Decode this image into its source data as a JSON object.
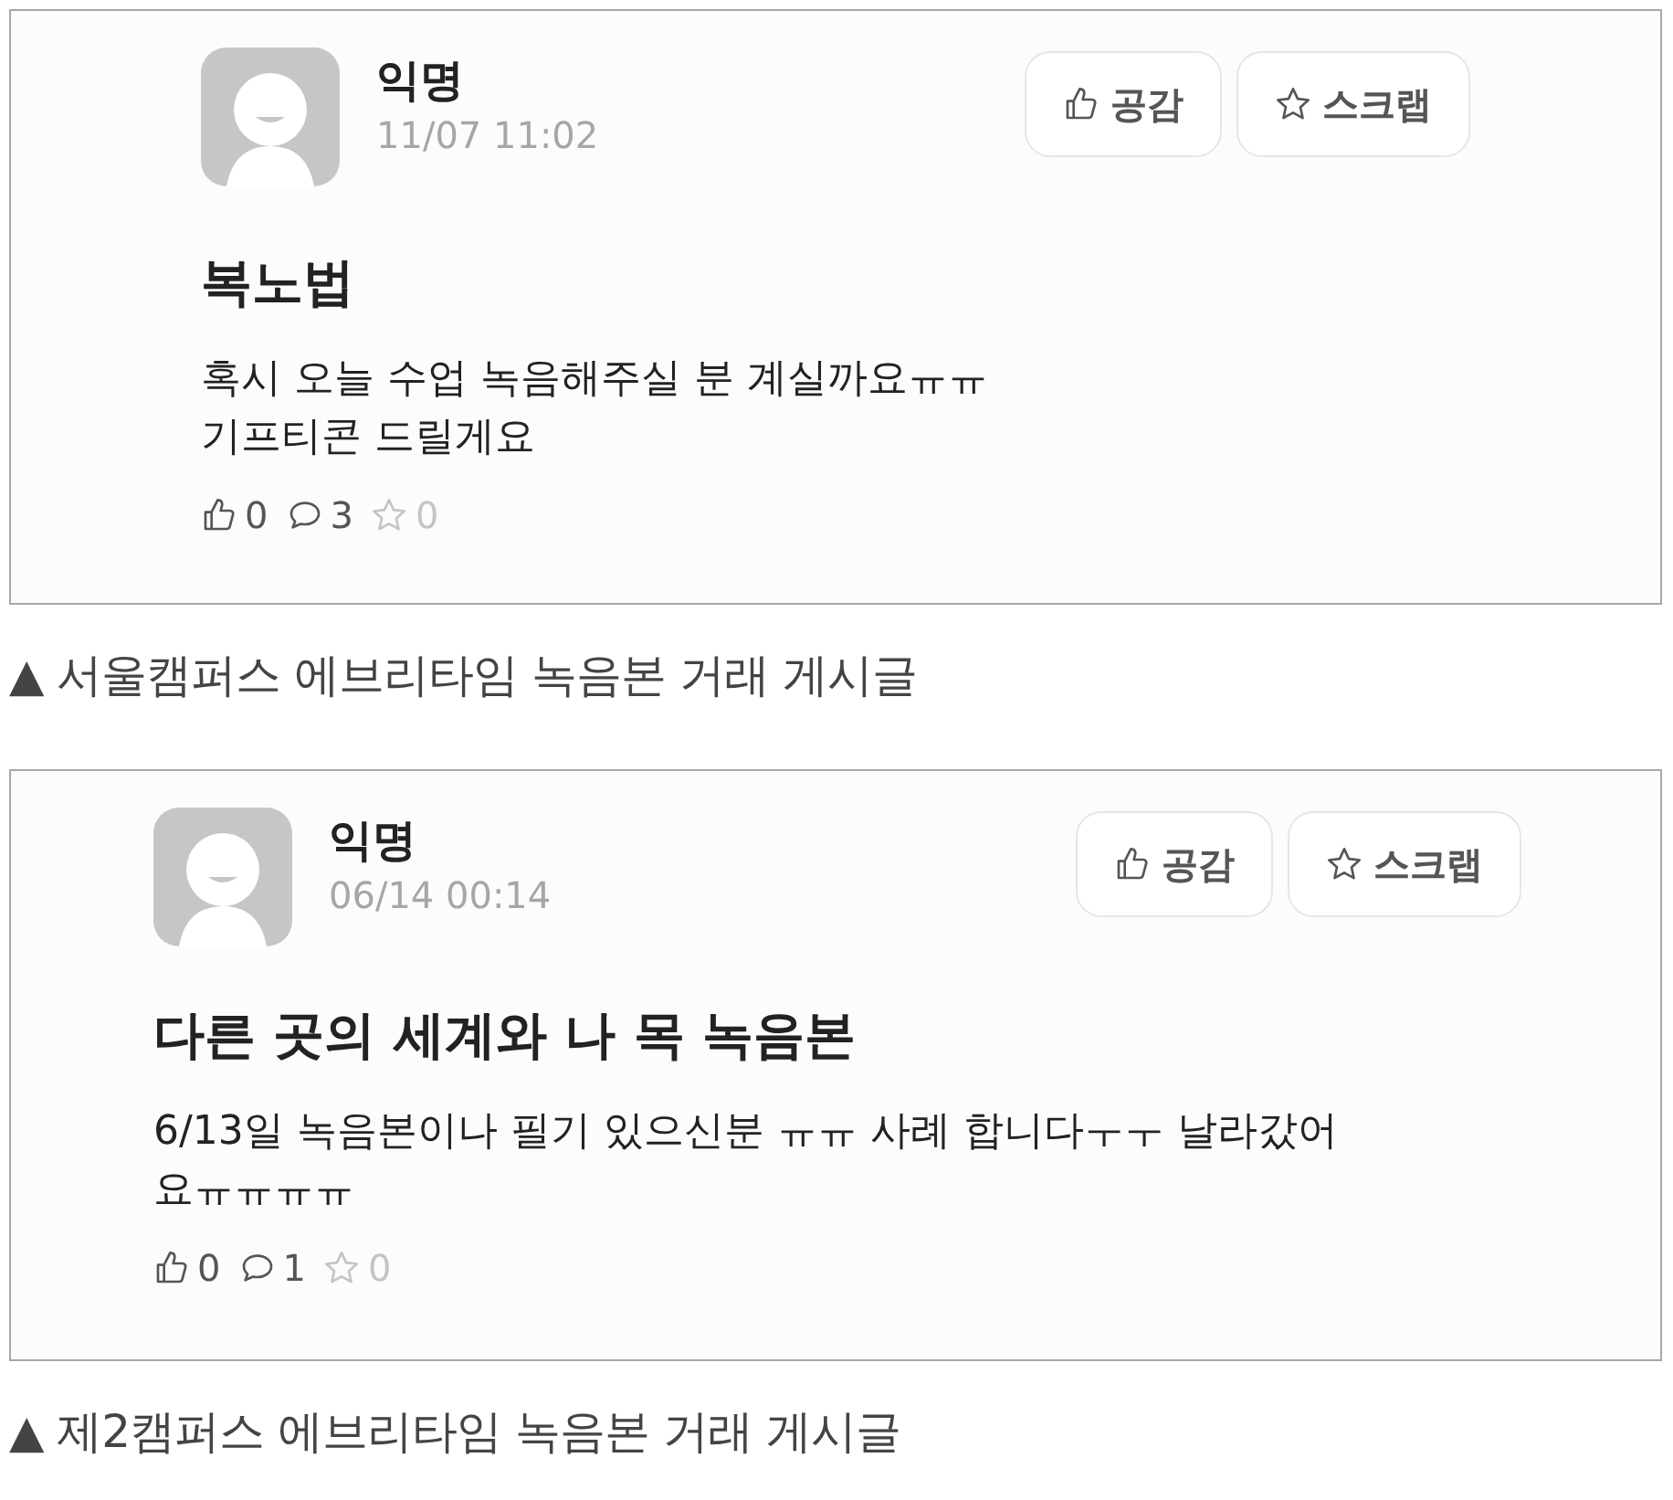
{
  "figures": [
    {
      "post": {
        "author": "익명",
        "time": "11/07 11:02",
        "title": "복노법",
        "body_lines": [
          "혹시 오늘 수업 녹음해주실 분 계실까요ㅠㅠ",
          "기프티콘 드릴게요"
        ],
        "buttons": [
          {
            "kind": "like",
            "label": "공감"
          },
          {
            "kind": "scrap",
            "label": "스크랩"
          }
        ],
        "stats": [
          {
            "kind": "like",
            "count": "0"
          },
          {
            "kind": "comment",
            "count": "3"
          },
          {
            "kind": "scrap",
            "count": "0"
          }
        ]
      },
      "caption": "▲ 서울캠퍼스 에브리타임 녹음본 거래 게시글"
    },
    {
      "post": {
        "author": "익명",
        "time": "06/14 00:14",
        "title": "다른 곳의 세계와 나 목 녹음본",
        "body_lines": [
          "6/13일 녹음본이나 필기 있으신분 ㅠㅠ 사례 합니다ㅜㅜ 날라갔어",
          "요ㅠㅠㅠㅠ"
        ],
        "buttons": [
          {
            "kind": "like",
            "label": "공감"
          },
          {
            "kind": "scrap",
            "label": "스크랩"
          }
        ],
        "stats": [
          {
            "kind": "like",
            "count": "0"
          },
          {
            "kind": "comment",
            "count": "1"
          },
          {
            "kind": "scrap",
            "count": "0"
          }
        ]
      },
      "caption": "▲ 제2캠퍼스 에브리타임 녹음본 거래 게시글"
    }
  ]
}
